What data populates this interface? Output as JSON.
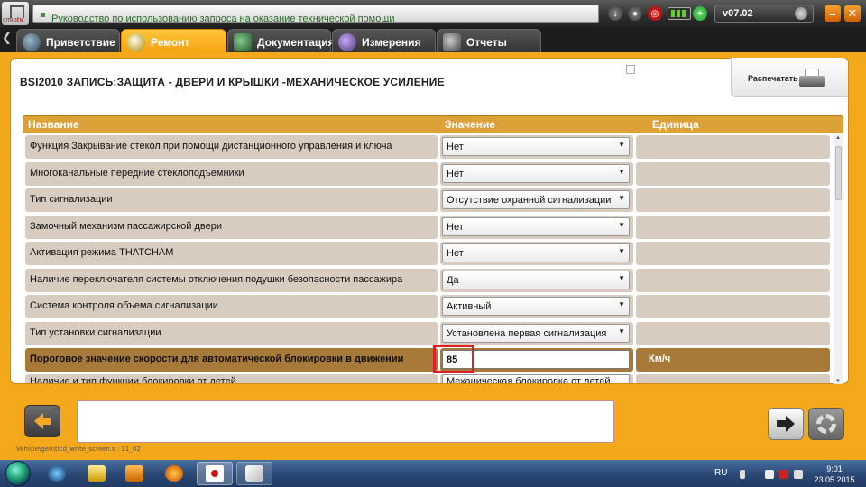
{
  "topbar": {
    "title": "Руководство по использованию запроса на оказание технической помощи",
    "version": "v07.02"
  },
  "tabs": [
    {
      "label": "Приветствие",
      "icon": "globe-icon",
      "active": false
    },
    {
      "label": "Ремонт",
      "icon": "magnifier-icon",
      "active": true
    },
    {
      "label": "Документация",
      "icon": "book-icon",
      "active": false
    },
    {
      "label": "Измерения",
      "icon": "wave-icon",
      "active": false
    },
    {
      "label": "Отчеты",
      "icon": "document-icon",
      "active": false
    }
  ],
  "page": {
    "title": "BSI2010  ЗАПИСЬ:ЗАЩИТА - ДВЕРИ И КРЫШКИ -МЕХАНИЧЕСКОЕ УСИЛЕНИЕ",
    "print_label": "Распечатать"
  },
  "table": {
    "headers": {
      "name": "Название",
      "value": "Значение",
      "unit": "Единица"
    },
    "rows": [
      {
        "name": "Функция Закрывание стекол при помощи дистанционного управления и ключа",
        "value": "Нет",
        "unit": ""
      },
      {
        "name": "Многоканальные передние стеклоподъемники",
        "value": "Нет",
        "unit": ""
      },
      {
        "name": "Тип сигнализации",
        "value": "Отсутствие охранной сигнализации",
        "unit": ""
      },
      {
        "name": "Замочный механизм пассажирской двери",
        "value": "Нет",
        "unit": ""
      },
      {
        "name": "Активация режима THATCHAM",
        "value": "Нет",
        "unit": ""
      },
      {
        "name": "Наличие переключателя системы отключения подушки безопасности пассажира",
        "value": "Да",
        "unit": ""
      },
      {
        "name": "Система контроля объема сигнализации",
        "value": "Активный",
        "unit": ""
      },
      {
        "name": "Тип установки сигнализации",
        "value": "Установлена первая сигнализация",
        "unit": ""
      },
      {
        "name": "Пороговое значение скорости для автоматической блокировки в движении",
        "value": "85",
        "unit": "Км/ч"
      },
      {
        "name": "Наличие и тип функции блокировки от детей",
        "value": "Механическая блокировка от детей",
        "unit": ""
      }
    ]
  },
  "footer": {
    "screen_path": "Vehicle\\gen\\tlcd_write_screen.s : 11_02"
  },
  "taskbar": {
    "language": "RU",
    "time": "9:01",
    "date": "23.05.2015"
  }
}
